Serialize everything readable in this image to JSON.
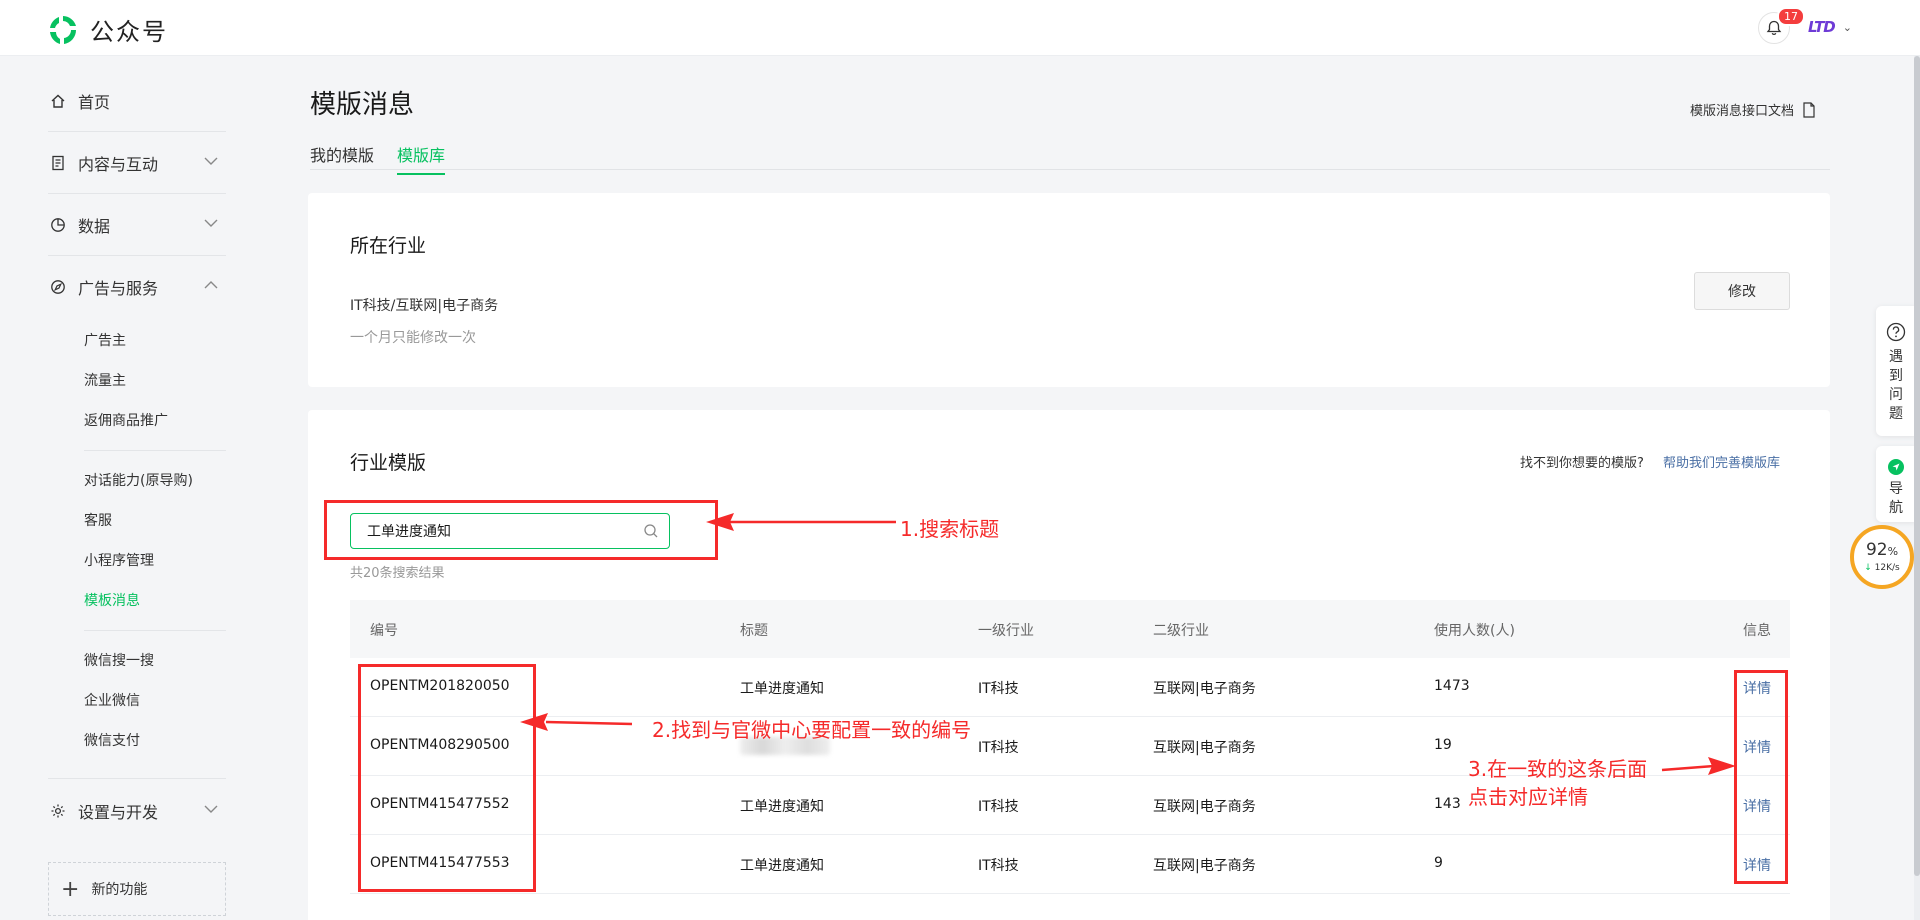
{
  "app": {
    "name": "公众号",
    "notification_count": "17",
    "user_name": "LTD"
  },
  "sidebar": {
    "home": "首页",
    "content": "内容与互动",
    "data": "数据",
    "ads": "广告与服务",
    "ads_items": [
      "广告主",
      "流量主",
      "返佣商品推广"
    ],
    "service_items": [
      "对话能力(原导购)",
      "客服",
      "小程序管理",
      "模板消息"
    ],
    "wechat_items": [
      "微信搜一搜",
      "企业微信",
      "微信支付"
    ],
    "settings": "设置与开发",
    "new_feature": "新的功能"
  },
  "page": {
    "title": "模版消息",
    "doc_link": "模版消息接口文档",
    "tabs": [
      "我的模版",
      "模版库"
    ]
  },
  "industry_card": {
    "title": "所在行业",
    "industry": "IT科技/互联网|电子商务",
    "hint": "一个月只能修改一次",
    "modify_label": "修改"
  },
  "template_card": {
    "title": "行业模版",
    "help_text": "找不到你想要的模版?",
    "help_link": "帮助我们完善模版库",
    "search_value": "工单进度通知",
    "result_count": "共20条搜索结果",
    "columns": [
      "编号",
      "标题",
      "一级行业",
      "二级行业",
      "使用人数(人)",
      "信息"
    ],
    "rows": [
      {
        "id": "OPENTM201820050",
        "title": "工单进度通知",
        "level1": "IT科技",
        "level2": "互联网|电子商务",
        "users": "1473",
        "info": "详情"
      },
      {
        "id": "OPENTM408290500",
        "title": "",
        "level1": "IT科技",
        "level2": "互联网|电子商务",
        "users": "19",
        "info": "详情"
      },
      {
        "id": "OPENTM415477552",
        "title": "工单进度通知",
        "level1": "IT科技",
        "level2": "互联网|电子商务",
        "users": "143",
        "info": "详情"
      },
      {
        "id": "OPENTM415477553",
        "title": "工单进度通知",
        "level1": "IT科技",
        "level2": "互联网|电子商务",
        "users": "9",
        "info": "详情"
      }
    ]
  },
  "annotations": {
    "step1": "1.搜索标题",
    "step2": "2.找到与官微中心要配置一致的编号",
    "step3_line1": "3.在一致的这条后面",
    "step3_line2": "点击对应详情",
    "color": "#f52a2a"
  },
  "float": {
    "help_chars": [
      "遇",
      "到",
      "问",
      "题"
    ],
    "nav_chars": [
      "导",
      "航"
    ],
    "meter_value": "92",
    "meter_unit": "%",
    "meter_speed": "12K/s"
  },
  "colors": {
    "accent": "#07c160",
    "link": "#4a6fa5"
  }
}
